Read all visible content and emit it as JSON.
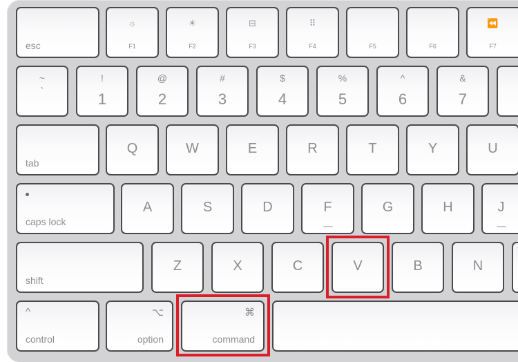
{
  "keyboard": {
    "row_fn": {
      "esc": "esc",
      "f1": {
        "label": "F1",
        "icon": "☼"
      },
      "f2": {
        "label": "F2",
        "icon": "☀"
      },
      "f3": {
        "label": "F3",
        "icon": "⊟"
      },
      "f4": {
        "label": "F4",
        "icon": "⠿"
      },
      "f5": {
        "label": "F5"
      },
      "f6": {
        "label": "F6"
      },
      "f7": {
        "label": "F7",
        "icon": "⏪"
      }
    },
    "row_num": [
      {
        "top": "~",
        "bottom": "`"
      },
      {
        "top": "!",
        "bottom": "1"
      },
      {
        "top": "@",
        "bottom": "2"
      },
      {
        "top": "#",
        "bottom": "3"
      },
      {
        "top": "$",
        "bottom": "4"
      },
      {
        "top": "%",
        "bottom": "5"
      },
      {
        "top": "^",
        "bottom": "6"
      },
      {
        "top": "&",
        "bottom": "7"
      }
    ],
    "row_qwerty": {
      "tab": "tab",
      "keys": [
        "Q",
        "W",
        "E",
        "R",
        "T",
        "Y",
        "U"
      ]
    },
    "row_home": {
      "caps_lock": "caps lock",
      "keys": [
        "A",
        "S",
        "D",
        "F",
        "G",
        "H",
        "J"
      ]
    },
    "row_shift": {
      "shift": "shift",
      "keys": [
        "Z",
        "X",
        "C",
        "V",
        "B",
        "N"
      ]
    },
    "row_bottom": {
      "control": {
        "label": "control",
        "symbol": "^"
      },
      "option": {
        "label": "option",
        "symbol": "⌥"
      },
      "command": {
        "label": "command",
        "symbol": "⌘"
      }
    }
  },
  "highlights": {
    "color": "#d9202a",
    "keys": [
      "V",
      "command"
    ]
  }
}
